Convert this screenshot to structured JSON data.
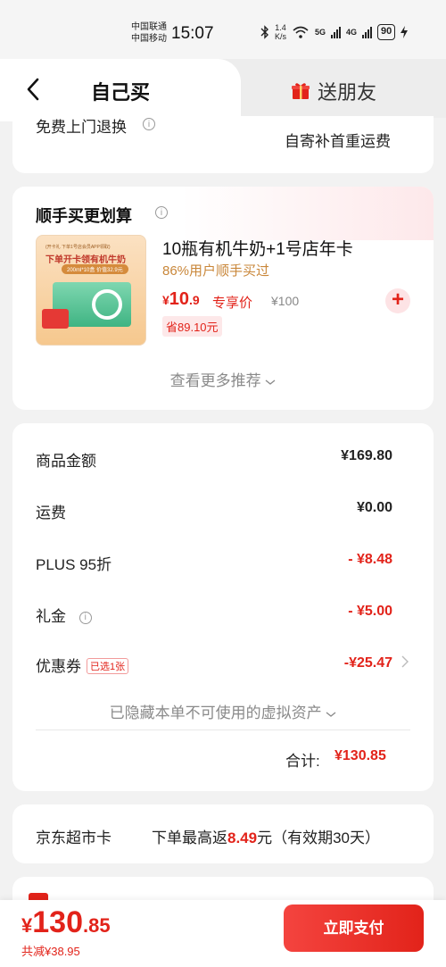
{
  "status_bar": {
    "carrier_1": "中国联通",
    "carrier_2": "中国移动",
    "time": "15:07",
    "speed_value": "1.4",
    "speed_unit": "K/s",
    "network_1": "5G",
    "network_2": "4G",
    "battery": "90"
  },
  "header": {
    "tab_self": "自己买",
    "tab_gift": "送朋友"
  },
  "service": {
    "label": "免费上门退换",
    "value": "自寄补首重运费"
  },
  "recommend": {
    "title": "顺手买更划算",
    "product": {
      "image_line_1": "(开卡礼 下单1号店会员APP领取)",
      "image_line_2": "下单开卡领有机牛奶",
      "image_line_3": "200ml*10盒  价值32.9元",
      "name": "10瓶有机牛奶+1号店年卡",
      "subtitle": "86%用户顺手买过",
      "price_symbol": "¥",
      "price_int": "10",
      "price_dec": ".9",
      "price_label": "专享价",
      "original_price": "¥100",
      "saving": "省89.10元",
      "add_label": "+"
    },
    "more_label": "查看更多推荐"
  },
  "summary": {
    "rows": [
      {
        "label": "商品金额",
        "value": "¥169.80"
      },
      {
        "label": "运费",
        "value": "¥0.00"
      },
      {
        "label": "PLUS 95折",
        "value": "- ¥8.48"
      },
      {
        "label": "礼金",
        "value": "- ¥5.00"
      },
      {
        "label": "优惠券",
        "tag": "已选1张",
        "value": "-¥25.47"
      }
    ],
    "hidden_assets": "已隐藏本单不可使用的虚拟资产",
    "total_label": "合计:",
    "total_value": "¥130.85"
  },
  "supermarket": {
    "label": "京东超市卡",
    "text_before": "下单最高返",
    "amount": "8.49",
    "text_after": "元（有效期30天）"
  },
  "footer": {
    "price_symbol": "¥",
    "price_int": "130",
    "price_dec": ".85",
    "saved": "共减¥38.95",
    "pay_button": "立即支付"
  },
  "colors": {
    "accent": "#e2231a",
    "gold": "#c9873a"
  }
}
